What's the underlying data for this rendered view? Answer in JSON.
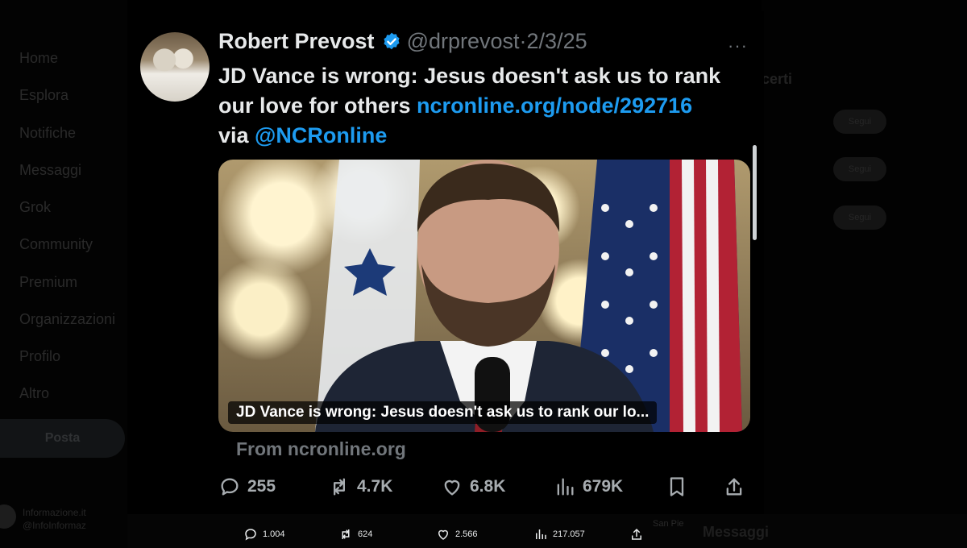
{
  "background": {
    "nav": [
      "Home",
      "Esplora",
      "Notifiche",
      "Messaggi",
      "Grok",
      "Community",
      "Premium",
      "Organizzazioni",
      "Profilo",
      "Altro"
    ],
    "post_button": "Posta",
    "account_name": "Informazione.it",
    "account_handle": "@InfoInformaz",
    "right_title": "certi",
    "follow_label": "Segui",
    "bottom_metrics": {
      "replies": "1.004",
      "reposts": "624",
      "likes": "2.566",
      "views": "217.057"
    },
    "messages_label": "Messaggi",
    "san_pie": "San Pie"
  },
  "tweet": {
    "author_name": "Robert Prevost",
    "handle": "@drprevost",
    "separator": "·",
    "date": "2/3/25",
    "more": "···",
    "text_main": "JD Vance is wrong: Jesus doesn't ask us to rank our love for others ",
    "link": "ncronline.org/node/292716",
    "text_via": " via ",
    "mention": "@NCRonline",
    "media_caption": "JD Vance is wrong: Jesus doesn't ask us to rank our lo...",
    "source": "From ncronline.org",
    "metrics": {
      "replies": "255",
      "reposts": "4.7K",
      "likes": "6.8K",
      "views": "679K"
    }
  },
  "colors": {
    "accent": "#1d9bf0",
    "muted": "#71767b",
    "text": "#e7e9ea",
    "background": "#000000"
  },
  "icons": [
    "verified-badge-icon",
    "more-icon",
    "reply-icon",
    "repost-icon",
    "like-icon",
    "views-icon",
    "bookmark-icon",
    "share-icon"
  ]
}
